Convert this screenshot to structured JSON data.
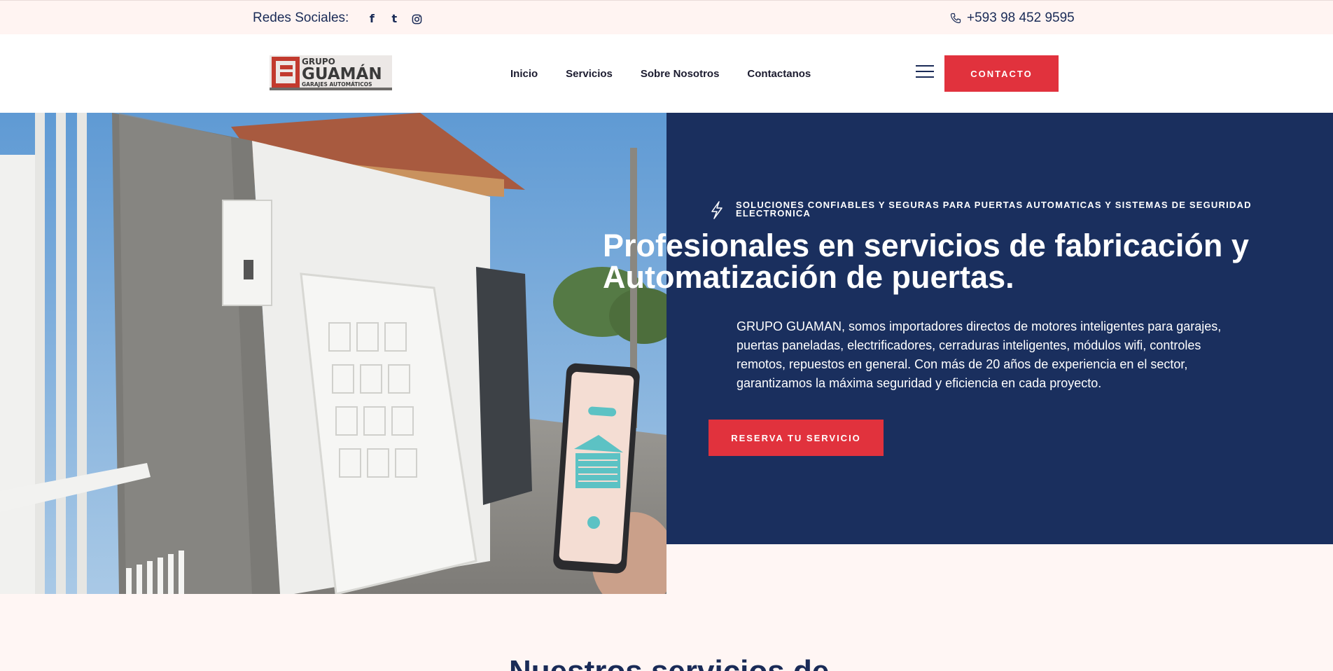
{
  "topbar": {
    "social_label": "Redes Sociales:",
    "social_icons": [
      "facebook-icon",
      "tumblr-icon",
      "instagram-icon"
    ],
    "phone": "+593 98 452 9595"
  },
  "header": {
    "logo_text_top": "GRUPO",
    "logo_text_main": "GUAMÁN",
    "logo_text_sub": "GARAJES AUTOMÁTICOS",
    "nav": [
      "Inicio",
      "Servicios",
      "Sobre Nosotros",
      "Contactanos"
    ],
    "contact_label": "CONTACTO"
  },
  "hero": {
    "eyebrow": "SOLUCIONES CONFIABLES Y SEGURAS PARA PUERTAS AUTOMATICAS Y SISTEMAS DE SEGURIDAD ELECTRONICA",
    "title": "Profesionales en servicios de fabricación y Automatización de puertas.",
    "brand": "GRUPO GUAMAN",
    "description": ", somos importadores directos de motores inteligentes para garajes, puertas paneladas, electrificadores, cerraduras inteligentes, módulos wifi, controles remotos, repuestos en general. Con más de 20 años de experiencia en el sector, garantizamos la máxima seguridad y eficiencia en cada proyecto.",
    "button_label": "RESERVA TU SERVICIO"
  },
  "section": {
    "title": "Nuestros servicios de"
  },
  "colors": {
    "navy": "#1a2f5e",
    "accent_red": "#e1323d",
    "top_bg": "#fff4f2"
  }
}
